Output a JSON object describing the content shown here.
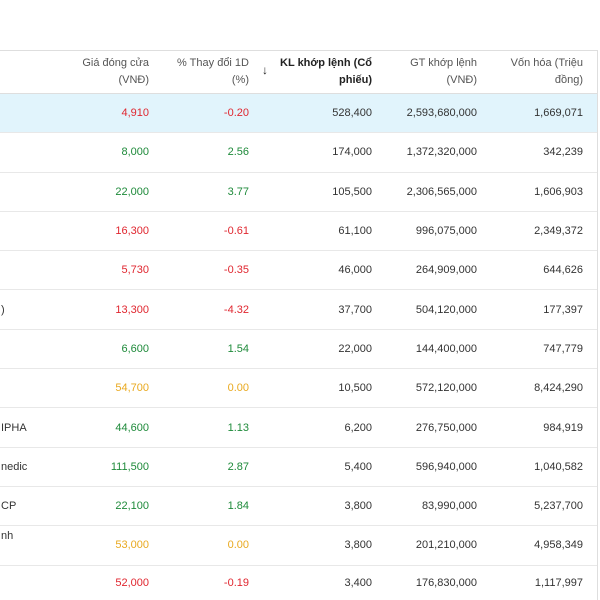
{
  "table": {
    "headers": {
      "price": {
        "line1": "Giá đóng cửa",
        "line2": "(VNĐ)"
      },
      "change": {
        "line1": "% Thay đổi 1D",
        "line2": "(%)"
      },
      "volume": {
        "line1": "KL khớp lệnh (Cổ",
        "line2": "phiếu)",
        "sort_icon": "arrow-down-icon",
        "sort_glyph": "↓"
      },
      "value": {
        "line1": "GT khớp lệnh",
        "line2": "(VNĐ)"
      },
      "cap": {
        "line1": "Vốn hóa (Triệu",
        "line2": "đồng)"
      }
    },
    "rows": [
      {
        "price": "4,910",
        "change": "-0.20",
        "volume": "528,400",
        "value": "2,593,680,000",
        "cap": "1,669,071",
        "color": "#e0262f",
        "highlighted": true
      },
      {
        "price": "8,000",
        "change": "2.56",
        "volume": "174,000",
        "value": "1,372,320,000",
        "cap": "342,239",
        "color": "#1e8a3a"
      },
      {
        "price": "22,000",
        "change": "3.77",
        "volume": "105,500",
        "value": "2,306,565,000",
        "cap": "1,606,903",
        "color": "#1e8a3a"
      },
      {
        "price": "16,300",
        "change": "-0.61",
        "volume": "61,100",
        "value": "996,075,000",
        "cap": "2,349,372",
        "color": "#e0262f"
      },
      {
        "price": "5,730",
        "change": "-0.35",
        "volume": "46,000",
        "value": "264,909,000",
        "cap": "644,626",
        "color": "#e0262f"
      },
      {
        "name": ")",
        "price": "13,300",
        "change": "-4.32",
        "volume": "37,700",
        "value": "504,120,000",
        "cap": "177,397",
        "color": "#e0262f"
      },
      {
        "price": "6,600",
        "change": "1.54",
        "volume": "22,000",
        "value": "144,400,000",
        "cap": "747,779",
        "color": "#1e8a3a"
      },
      {
        "price": "54,700",
        "change": "0.00",
        "volume": "10,500",
        "value": "572,120,000",
        "cap": "8,424,290",
        "color": "#e9a91f"
      },
      {
        "name": "IPHA",
        "price": "44,600",
        "change": "1.13",
        "volume": "6,200",
        "value": "276,750,000",
        "cap": "984,919",
        "color": "#1e8a3a"
      },
      {
        "name": "nedic",
        "price": "111,500",
        "change": "2.87",
        "volume": "5,400",
        "value": "596,940,000",
        "cap": "1,040,582",
        "color": "#1e8a3a"
      },
      {
        "name": "CP",
        "price": "22,100",
        "change": "1.84",
        "volume": "3,800",
        "value": "83,990,000",
        "cap": "5,237,700",
        "color": "#1e8a3a"
      },
      {
        "name": "nh",
        "price": "53,000",
        "change": "0.00",
        "volume": "3,800",
        "value": "201,210,000",
        "cap": "4,958,349",
        "color": "#e9a91f"
      },
      {
        "price": "52,000",
        "change": "-0.19",
        "volume": "3,400",
        "value": "176,830,000",
        "cap": "1,117,997",
        "color": "#e0262f"
      }
    ]
  },
  "colors": {
    "up": "#1e8a3a",
    "down": "#e0262f",
    "flat": "#e9a91f",
    "highlight": "#e1f4fc"
  }
}
